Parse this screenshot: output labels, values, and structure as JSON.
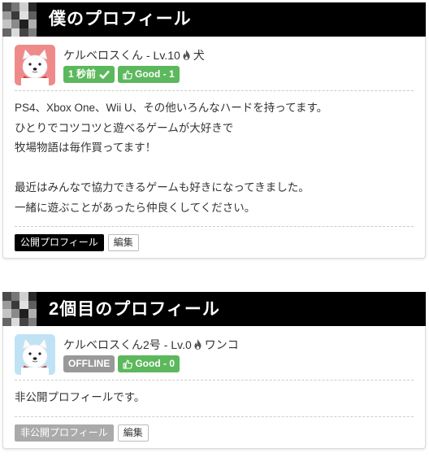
{
  "colors": {
    "header_bg": "#000000",
    "badge_green": "#5cb85c",
    "badge_gray": "#999999",
    "button_dark": "#000000",
    "button_muted": "#aaaaaa"
  },
  "profiles": [
    {
      "title": "僕のプロフィール",
      "name": "ケルベロスくん",
      "level": "- Lv.10",
      "tag": "犬",
      "status": "1 秒前",
      "good": "Good - 1",
      "bio": [
        "PS4、Xbox One、Wii U、その他いろんなハードを持ってます。",
        "ひとりでコツコツと遊べるゲームが大好きで",
        "牧場物語は毎作買ってます！",
        "",
        "最近はみんなで協力できるゲームも好きになってきました。",
        "一緒に遊ぶことがあったら仲良くしてください。"
      ],
      "visibility_button": "公開プロフィール",
      "edit_button": "編集"
    },
    {
      "title_num": "2",
      "title": "個目のプロフィール",
      "name": "ケルベロスくん2号",
      "level": "- Lv.0",
      "tag": "ワンコ",
      "status": "OFFLINE",
      "good": "Good - 0",
      "bio": [
        "非公開プロフィールです。"
      ],
      "visibility_button": "非公開プロフィール",
      "edit_button": "編集"
    }
  ]
}
